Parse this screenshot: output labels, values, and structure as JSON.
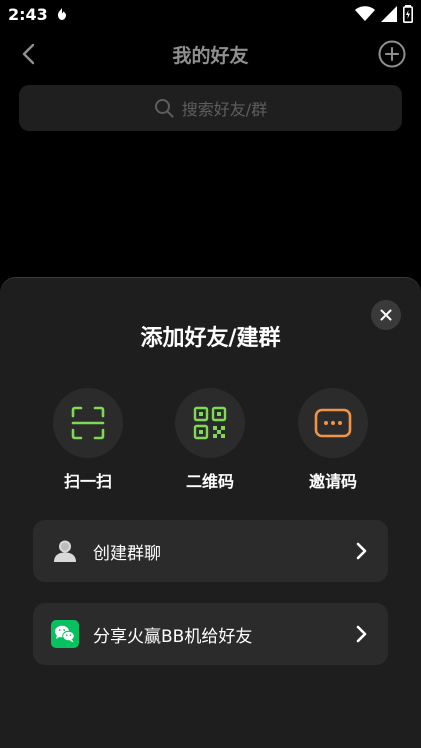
{
  "status_bar": {
    "time": "2:43"
  },
  "header": {
    "title": "我的好友"
  },
  "search": {
    "placeholder": "搜索好友/群"
  },
  "sheet": {
    "title": "添加好友/建群",
    "actions": [
      {
        "label": "扫一扫",
        "icon": "scan-icon",
        "color": "#7ed957"
      },
      {
        "label": "二维码",
        "icon": "qr-code-icon",
        "color": "#7ed957"
      },
      {
        "label": "邀请码",
        "icon": "invite-code-icon",
        "color": "#f0944a"
      }
    ],
    "menu": [
      {
        "label": "创建群聊",
        "icon": "person-icon"
      },
      {
        "label": "分享火赢BB机给好友",
        "icon": "wechat-icon",
        "color": "#07c160"
      }
    ]
  }
}
